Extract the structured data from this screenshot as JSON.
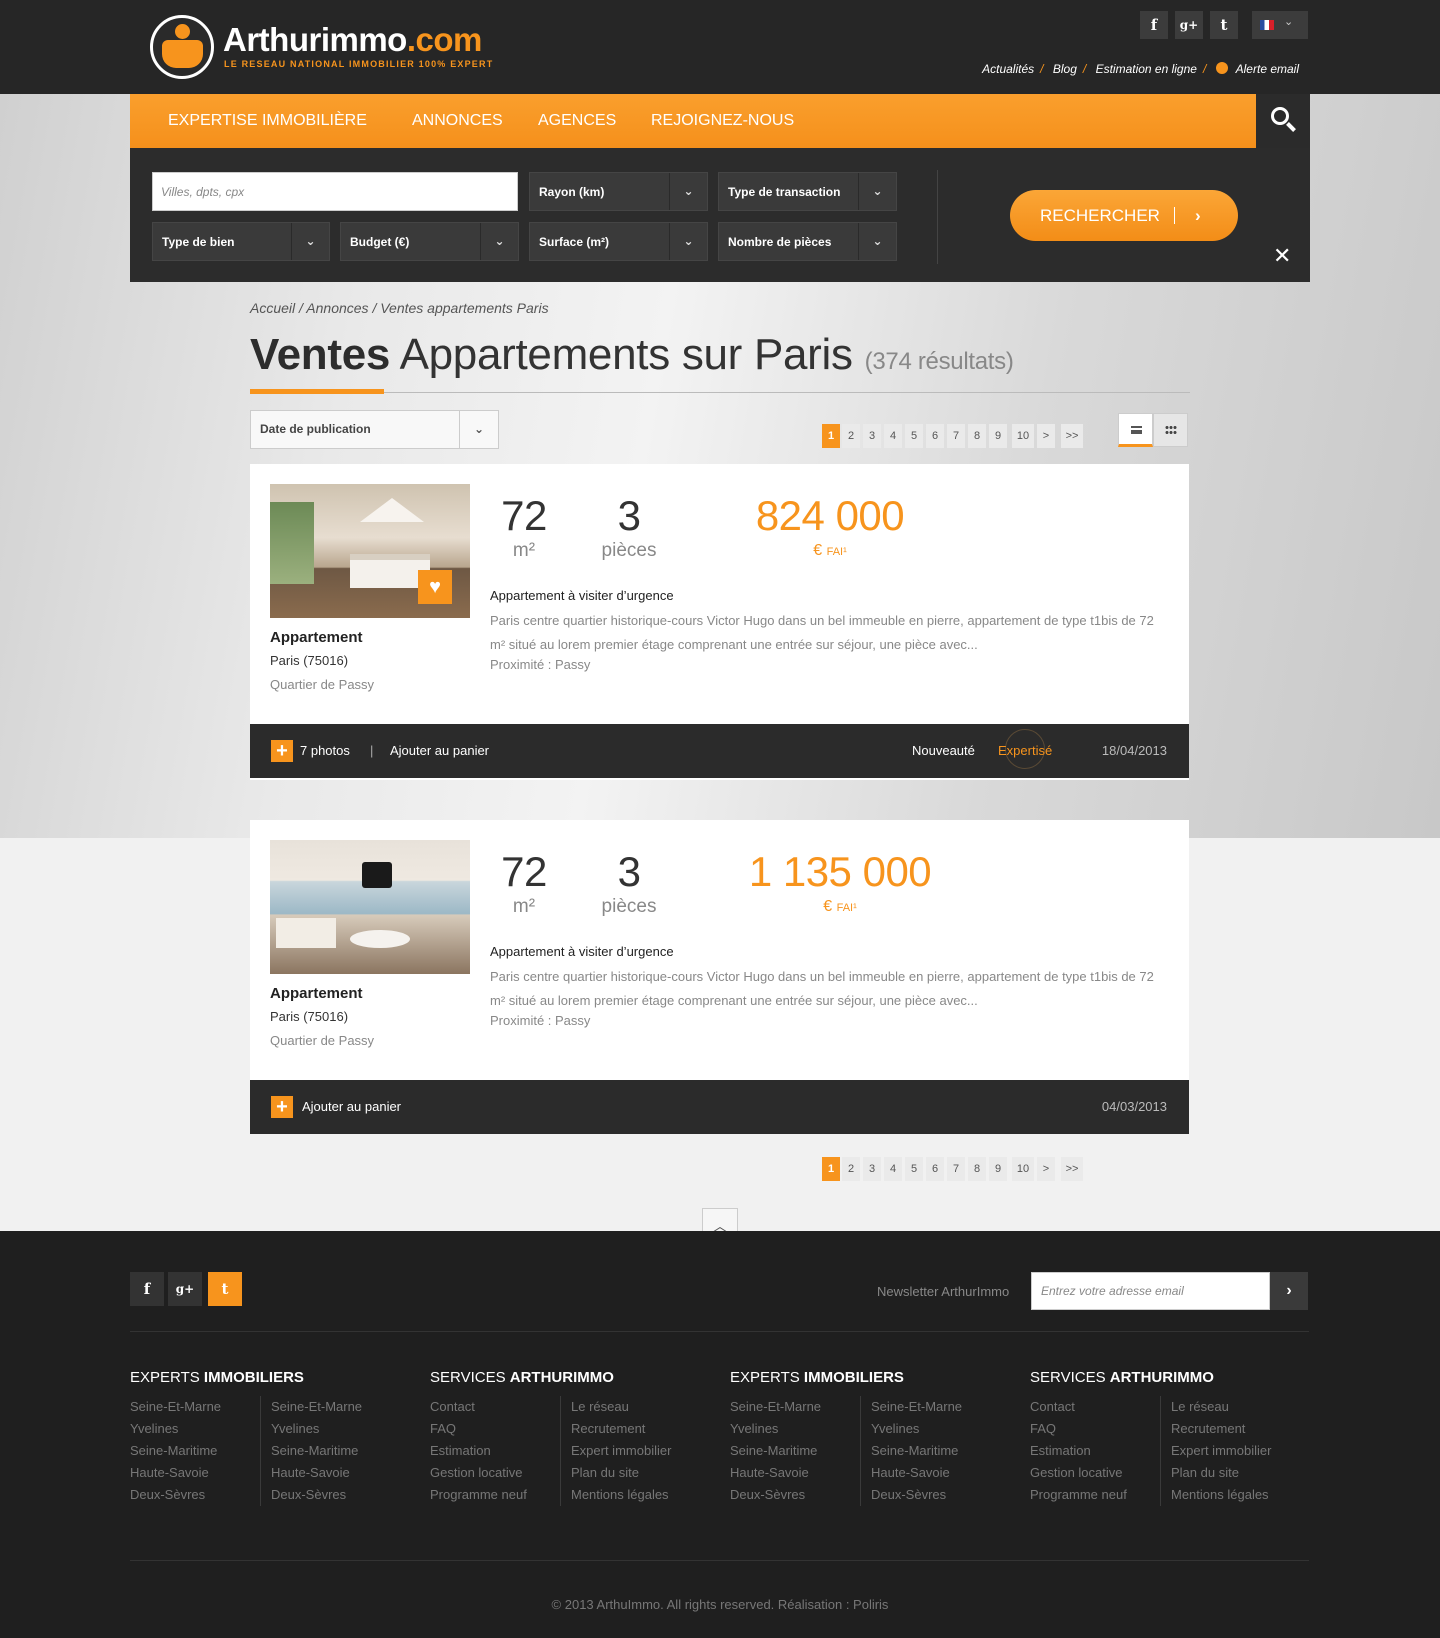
{
  "brand": {
    "name_main": "Arthurimmo",
    "name_ext": ".com",
    "tagline": "LE RESEAU NATIONAL IMMOBILIER 100% EXPERT"
  },
  "header": {
    "social": [
      {
        "icon": "facebook-icon",
        "glyph": "f"
      },
      {
        "icon": "google-plus-icon",
        "glyph": "g+"
      },
      {
        "icon": "twitter-icon",
        "glyph": "t"
      }
    ],
    "links": [
      "Actualités",
      "Blog",
      "Estimation en ligne",
      "Alerte email"
    ]
  },
  "nav": {
    "items": [
      "EXPERTISE IMMOBILIÈRE",
      "ANNONCES",
      "AGENCES",
      "REJOIGNEZ-NOUS"
    ]
  },
  "search": {
    "city_placeholder": "Villes, dpts, cpx",
    "fields": [
      "Rayon (km)",
      "Type de transaction",
      "Type de bien",
      "Budget (€)",
      "Surface (m²)",
      "Nombre de pièces"
    ],
    "submit": "RECHERCHER"
  },
  "breadcrumb": "Accueil / Annonces / Ventes appartements Paris",
  "title": {
    "bold": "Ventes",
    "rest": "Appartements sur Paris",
    "count": "(374 résultats)"
  },
  "sort": {
    "selected": "Date de publication"
  },
  "pagination": {
    "pages": [
      "1",
      "2",
      "3",
      "4",
      "5",
      "6",
      "7",
      "8",
      "9",
      "10",
      ">",
      ">>"
    ],
    "current": "1"
  },
  "listings": [
    {
      "surface": "72",
      "surface_unit": "m²",
      "rooms": "3",
      "rooms_unit": "pièces",
      "price": "824 000",
      "currency": "€",
      "price_suffix": "FAI¹",
      "type": "Appartement",
      "city": "Paris (75016)",
      "quarter": "Quartier de Passy",
      "headline": "Appartement à visiter d’urgence",
      "description": "Paris centre quartier historique-cours Victor Hugo dans un bel immeuble en pierre, appartement de type t1bis de 72 m² situé au lorem premier étage comprenant une entrée sur séjour, une pièce avec...",
      "proximity": "Proximité : Passy",
      "photos": "7 photos",
      "cart": "Ajouter au panier",
      "badge_new": "Nouveauté",
      "badge_expert": "Expertisé",
      "date": "18/04/2013"
    },
    {
      "surface": "72",
      "surface_unit": "m²",
      "rooms": "3",
      "rooms_unit": "pièces",
      "price": "1 135 000",
      "currency": "€",
      "price_suffix": "FAI¹",
      "type": "Appartement",
      "city": "Paris (75016)",
      "quarter": "Quartier de Passy",
      "headline": "Appartement à visiter d’urgence",
      "description": "Paris centre quartier historique-cours Victor Hugo dans un bel immeuble en pierre, appartement de type t1bis de 72 m² situé au lorem premier étage comprenant une entrée sur séjour, une pièce avec...",
      "proximity": "Proximité : Passy",
      "cart": "Ajouter au panier",
      "date": "04/03/2013"
    }
  ],
  "footer": {
    "newsletter_label": "Newsletter ArthurImmo",
    "newsletter_placeholder": "Entrez votre adresse email",
    "columns": [
      {
        "heading_light": "EXPERTS",
        "heading_bold": "IMMOBILIERS",
        "left": [
          "Seine-Et-Marne",
          "Yvelines",
          "Seine-Maritime",
          "Haute-Savoie",
          "Deux-Sèvres"
        ],
        "right": [
          "Seine-Et-Marne",
          "Yvelines",
          "Seine-Maritime",
          "Haute-Savoie",
          "Deux-Sèvres"
        ]
      },
      {
        "heading_light": "SERVICES",
        "heading_bold": "ARTHURIMMO",
        "left": [
          "Contact",
          "FAQ",
          "Estimation",
          "Gestion locative",
          "Programme neuf"
        ],
        "right": [
          "Le réseau",
          "Recrutement",
          "Expert immobilier",
          "Plan du site",
          "Mentions légales"
        ]
      },
      {
        "heading_light": "EXPERTS",
        "heading_bold": "IMMOBILIERS",
        "left": [
          "Seine-Et-Marne",
          "Yvelines",
          "Seine-Maritime",
          "Haute-Savoie",
          "Deux-Sèvres"
        ],
        "right": [
          "Seine-Et-Marne",
          "Yvelines",
          "Seine-Maritime",
          "Haute-Savoie",
          "Deux-Sèvres"
        ]
      },
      {
        "heading_light": "SERVICES",
        "heading_bold": "ARTHURIMMO",
        "left": [
          "Contact",
          "FAQ",
          "Estimation",
          "Gestion locative",
          "Programme neuf"
        ],
        "right": [
          "Le réseau",
          "Recrutement",
          "Expert immobilier",
          "Plan du site",
          "Mentions légales"
        ]
      }
    ],
    "copyright": "© 2013 ArthuImmo. All rights reserved. Réalisation : Poliris"
  },
  "colors": {
    "accent": "#f7941d",
    "dark": "#262626",
    "footer": "#1f1f1f"
  }
}
